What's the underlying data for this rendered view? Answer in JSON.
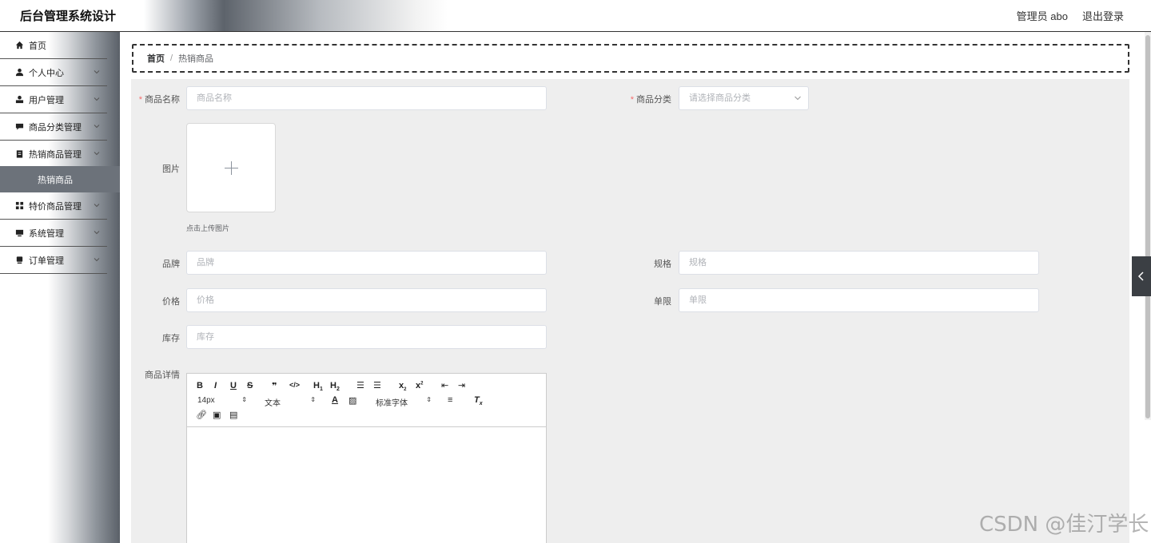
{
  "header": {
    "title": "后台管理系统设计",
    "user": "管理员 abo",
    "logout": "退出登录"
  },
  "sidebar": {
    "items": [
      {
        "label": "首页",
        "icon": "home-icon"
      },
      {
        "label": "个人中心",
        "icon": "user-icon"
      },
      {
        "label": "用户管理",
        "icon": "user-manage-icon"
      },
      {
        "label": "商品分类管理",
        "icon": "comment-icon"
      },
      {
        "label": "热销商品管理",
        "icon": "clipboard-icon"
      },
      {
        "label": "特价商品管理",
        "icon": "grid-icon"
      },
      {
        "label": "系统管理",
        "icon": "monitor-icon"
      },
      {
        "label": "订单管理",
        "icon": "order-icon"
      }
    ],
    "active_sub": "热销商品"
  },
  "breadcrumb": {
    "home": "首页",
    "separator": "/",
    "current": "热销商品"
  },
  "form": {
    "name_label": "商品名称",
    "name_placeholder": "商品名称",
    "category_label": "商品分类",
    "category_placeholder": "请选择商品分类",
    "image_label": "图片",
    "upload_tip": "点击上传图片",
    "brand_label": "品牌",
    "brand_placeholder": "品牌",
    "spec_label": "规格",
    "spec_placeholder": "规格",
    "price_label": "价格",
    "price_placeholder": "价格",
    "limit_label": "单限",
    "limit_placeholder": "单限",
    "stock_label": "库存",
    "stock_placeholder": "库存",
    "detail_label": "商品详情"
  },
  "editor": {
    "font_size": "14px",
    "text_style": "文本",
    "font_family": "标准字体"
  },
  "watermark": "CSDN @佳汀学长",
  "colors": {
    "required": "#f56c6c",
    "active_sub_bg": "#6c727a"
  }
}
